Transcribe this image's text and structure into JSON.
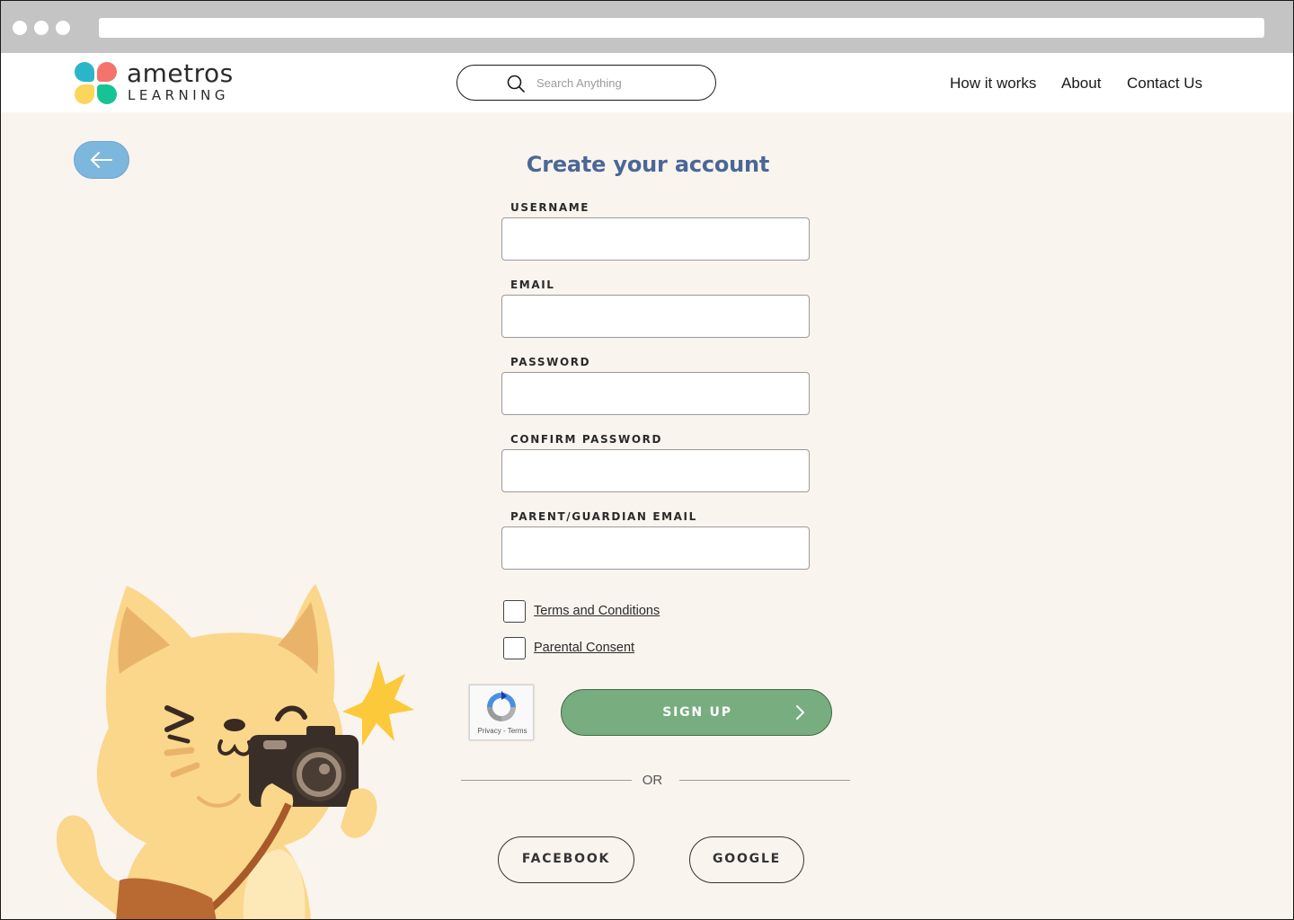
{
  "brand": {
    "name": "ametros",
    "tagline": "LEARNING",
    "colors": {
      "teal": "#2bb5c8",
      "coral": "#f4736b",
      "yellow": "#fcd55d",
      "green": "#16c394"
    }
  },
  "search": {
    "placeholder": "Search Anything",
    "icon": "search-icon"
  },
  "nav": {
    "items": [
      "How it works",
      "About",
      "Contact Us"
    ]
  },
  "back_button": {
    "icon": "arrow-left-icon"
  },
  "form": {
    "title": "Create your account",
    "fields": [
      {
        "label": "USERNAME",
        "value": ""
      },
      {
        "label": "EMAIL",
        "value": ""
      },
      {
        "label": "PASSWORD",
        "value": ""
      },
      {
        "label": "CONFIRM PASSWORD",
        "value": ""
      },
      {
        "label": "PARENT/GUARDIAN EMAIL",
        "value": ""
      }
    ],
    "checkboxes": [
      {
        "label": "Terms and Conditions",
        "checked": false
      },
      {
        "label": "Parental Consent",
        "checked": false
      }
    ],
    "recaptcha_text": "Privacy - Terms",
    "submit_label": "SIGN UP",
    "divider_text": "OR",
    "social": {
      "facebook_label": "FACEBOOK",
      "google_label": "GOOGLE"
    }
  },
  "colors": {
    "background": "#faf4ee",
    "title": "#4a6896",
    "signup_button": "#78ad7f",
    "back_button": "#7eb7de"
  },
  "illustration": "cat-with-camera-illustration"
}
